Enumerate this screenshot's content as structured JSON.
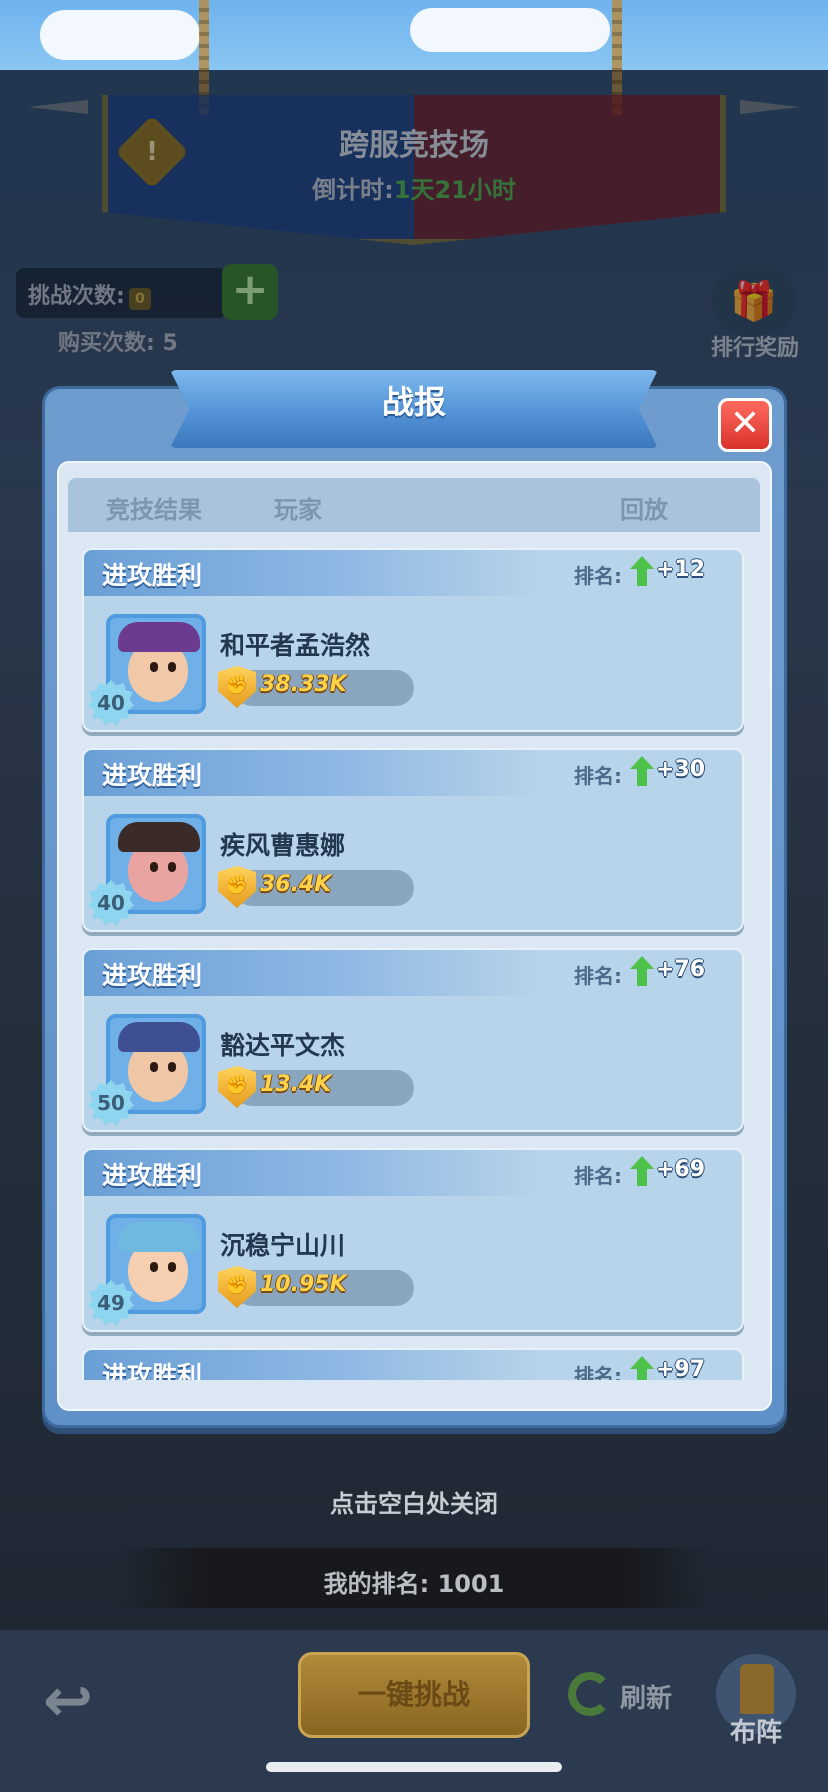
{
  "arena": {
    "title": "跨服竞技场",
    "countdown_label": "倒计时:",
    "countdown_value": "1天21小时"
  },
  "challenge": {
    "label": "挑战次数:",
    "count": "0",
    "buy_label": "购买次数:",
    "buy_count": "5"
  },
  "reward_label": "排行奖励",
  "modal": {
    "title": "战报",
    "columns": {
      "result": "竞技结果",
      "player": "玩家",
      "replay": "回放"
    },
    "rank_label": "排名:",
    "cards": [
      {
        "result": "进攻胜利",
        "rank_change": "+12",
        "name": "和平者孟浩然",
        "power": "38.33K",
        "level": "40",
        "avatar": "pirate-captain-icon",
        "skin": "#f1c9a8",
        "hat": "#6a3b8f"
      },
      {
        "result": "进攻胜利",
        "rank_change": "+30",
        "name": "疾风曹惠娜",
        "power": "36.4K",
        "level": "40",
        "avatar": "boar-warrior-icon",
        "skin": "#e9a3a0",
        "hat": "#3a2a28"
      },
      {
        "result": "进攻胜利",
        "rank_change": "+76",
        "name": "豁达平文杰",
        "power": "13.4K",
        "level": "50",
        "avatar": "goggle-engineer-icon",
        "skin": "#efc6a6",
        "hat": "#3f4f93"
      },
      {
        "result": "进攻胜利",
        "rank_change": "+69",
        "name": "沉稳宁山川",
        "power": "10.95K",
        "level": "49",
        "avatar": "young-hero-icon",
        "skin": "#f6cfb1",
        "hat": "#6fb8e0"
      },
      {
        "result": "进攻胜利",
        "rank_change": "+97",
        "name": "",
        "power": "",
        "level": "",
        "avatar": "",
        "skin": "#f1c9a8",
        "hat": "#6fb8e0"
      }
    ]
  },
  "hint": "点击空白处关闭",
  "my_rank": "我的排名: 1001",
  "bottom": {
    "challenge_button": "一键挑战",
    "refresh_label": "刷新",
    "formation_label": "布阵"
  },
  "colors": {
    "modal_blue": "#5f90c8",
    "card_bg": "#b8d4ea",
    "power_text": "#ffd24a",
    "rank_up_arrow": "#4cc24a",
    "close_red": "#d8322b"
  }
}
